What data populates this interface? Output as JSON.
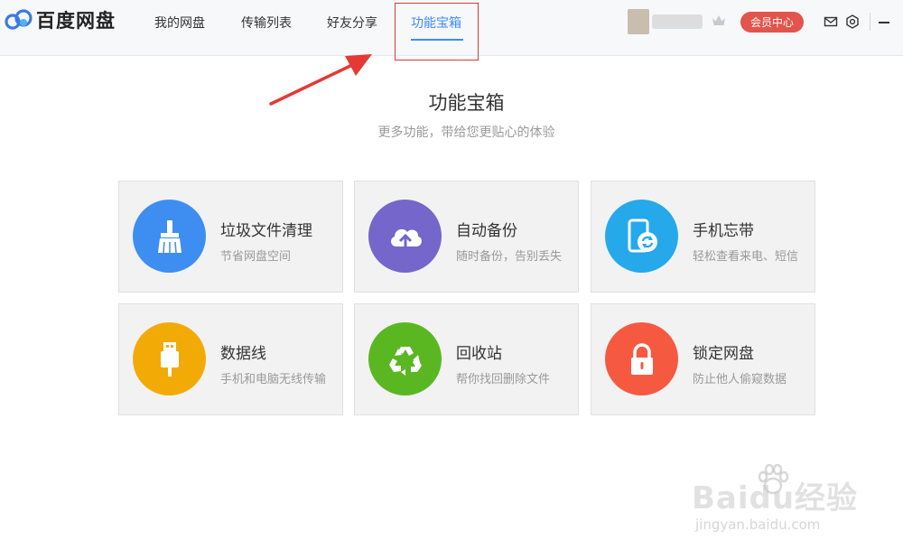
{
  "app": {
    "logo_text": "百度网盘"
  },
  "nav": {
    "tabs": [
      {
        "label": "我的网盘"
      },
      {
        "label": "传输列表"
      },
      {
        "label": "好友分享"
      },
      {
        "label": "功能宝箱"
      }
    ],
    "active_tab": "功能宝箱"
  },
  "header": {
    "vip_label": "会员中心",
    "icons": [
      "mail-icon",
      "settings-icon",
      "minimize-icon"
    ]
  },
  "main": {
    "title": "功能宝箱",
    "subtitle": "更多功能，带给您更贴心的体验"
  },
  "features": [
    {
      "title": "垃圾文件清理",
      "desc": "节省网盘空间",
      "color": "#3d8ef0",
      "icon": "broom-icon"
    },
    {
      "title": "自动备份",
      "desc": "随时备份，告别丢失",
      "color": "#7466cb",
      "icon": "cloud-upload-icon"
    },
    {
      "title": "手机忘带",
      "desc": "轻松查看来电、短信",
      "color": "#25a9ea",
      "icon": "phone-sync-icon"
    },
    {
      "title": "数据线",
      "desc": "手机和电脑无线传输",
      "color": "#f2ab06",
      "icon": "usb-cable-icon"
    },
    {
      "title": "回收站",
      "desc": "帮你找回删除文件",
      "color": "#5ab722",
      "icon": "recycle-icon"
    },
    {
      "title": "锁定网盘",
      "desc": "防止他人偷窥数据",
      "color": "#f55a41",
      "icon": "lock-icon"
    }
  ],
  "watermark": {
    "main": "Baidu经验",
    "sub": "jingyan.baidu.com"
  },
  "colors": {
    "accent": "#3b8cff",
    "vip": "#e2544c",
    "annotation": "#e53935"
  }
}
